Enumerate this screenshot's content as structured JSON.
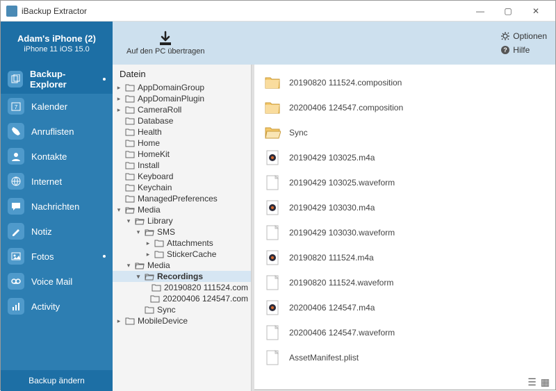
{
  "app": {
    "title": "iBackup Extractor"
  },
  "device": {
    "name": "Adam's iPhone (2)",
    "model": "iPhone 11 iOS 15.0"
  },
  "toolbar": {
    "transfer_label": "Auf den PC übertragen",
    "options_label": "Optionen",
    "help_label": "Hilfe"
  },
  "sidebar": {
    "items": [
      {
        "label": "Backup-Explorer",
        "icon": "copy",
        "active": true,
        "dot": true
      },
      {
        "label": "Kalender",
        "icon": "calendar"
      },
      {
        "label": "Anruflisten",
        "icon": "phone"
      },
      {
        "label": "Kontakte",
        "icon": "user"
      },
      {
        "label": "Internet",
        "icon": "globe"
      },
      {
        "label": "Nachrichten",
        "icon": "chat"
      },
      {
        "label": "Notiz",
        "icon": "pencil"
      },
      {
        "label": "Fotos",
        "icon": "photo",
        "dot": true
      },
      {
        "label": "Voice Mail",
        "icon": "voicemail"
      },
      {
        "label": "Activity",
        "icon": "chart"
      }
    ],
    "change_backup": "Backup ändern"
  },
  "tree": {
    "header": "Datein",
    "nodes": [
      {
        "label": "AppDomainGroup",
        "depth": 0,
        "arrow": "▸"
      },
      {
        "label": "AppDomainPlugin",
        "depth": 0,
        "arrow": "▸"
      },
      {
        "label": "CameraRoll",
        "depth": 0,
        "arrow": "▸"
      },
      {
        "label": "Database",
        "depth": 0,
        "arrow": ""
      },
      {
        "label": "Health",
        "depth": 0,
        "arrow": ""
      },
      {
        "label": "Home",
        "depth": 0,
        "arrow": ""
      },
      {
        "label": "HomeKit",
        "depth": 0,
        "arrow": ""
      },
      {
        "label": "Install",
        "depth": 0,
        "arrow": ""
      },
      {
        "label": "Keyboard",
        "depth": 0,
        "arrow": ""
      },
      {
        "label": "Keychain",
        "depth": 0,
        "arrow": ""
      },
      {
        "label": "ManagedPreferences",
        "depth": 0,
        "arrow": ""
      },
      {
        "label": "Media",
        "depth": 0,
        "arrow": "▾",
        "open": true
      },
      {
        "label": "Library",
        "depth": 1,
        "arrow": "▾",
        "open": true
      },
      {
        "label": "SMS",
        "depth": 2,
        "arrow": "▾",
        "open": true
      },
      {
        "label": "Attachments",
        "depth": 3,
        "arrow": "▸"
      },
      {
        "label": "StickerCache",
        "depth": 3,
        "arrow": "▸"
      },
      {
        "label": "Media",
        "depth": 1,
        "arrow": "▾",
        "open": true
      },
      {
        "label": "Recordings",
        "depth": 2,
        "arrow": "▾",
        "open": true,
        "selected": true
      },
      {
        "label": "20190820 111524.com",
        "depth": 3,
        "arrow": ""
      },
      {
        "label": "20200406 124547.com",
        "depth": 3,
        "arrow": ""
      },
      {
        "label": "Sync",
        "depth": 2,
        "arrow": ""
      },
      {
        "label": "MobileDevice",
        "depth": 0,
        "arrow": "▸"
      }
    ]
  },
  "files": {
    "items": [
      {
        "name": "20190820 111524.composition",
        "type": "folder"
      },
      {
        "name": "20200406 124547.composition",
        "type": "folder"
      },
      {
        "name": "Sync",
        "type": "folder-open"
      },
      {
        "name": "20190429 103025.m4a",
        "type": "audio"
      },
      {
        "name": "20190429 103025.waveform",
        "type": "file"
      },
      {
        "name": "20190429 103030.m4a",
        "type": "audio"
      },
      {
        "name": "20190429 103030.waveform",
        "type": "file"
      },
      {
        "name": "20190820 111524.m4a",
        "type": "audio"
      },
      {
        "name": "20190820 111524.waveform",
        "type": "file"
      },
      {
        "name": "20200406 124547.m4a",
        "type": "audio"
      },
      {
        "name": "20200406 124547.waveform",
        "type": "file"
      },
      {
        "name": "AssetManifest.plist",
        "type": "file"
      }
    ]
  }
}
